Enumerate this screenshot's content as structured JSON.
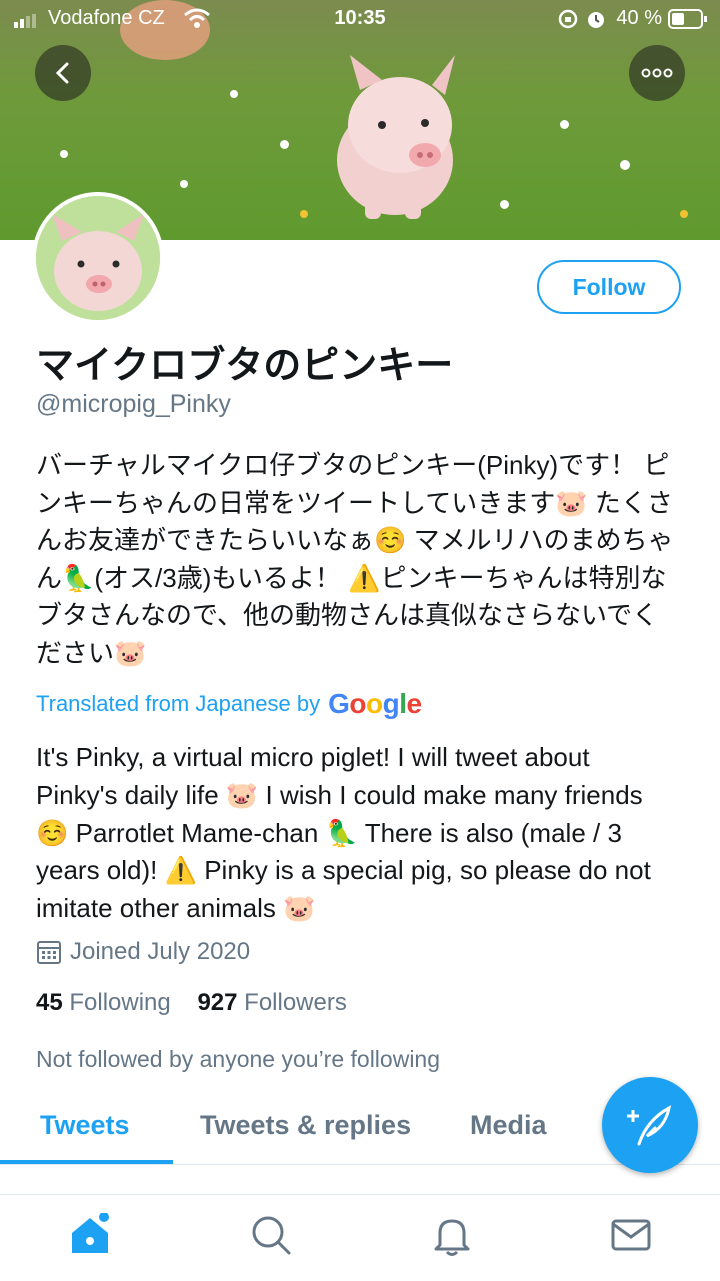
{
  "status_bar": {
    "carrier": "Vodafone CZ",
    "time": "10:35",
    "battery": "40 %"
  },
  "profile": {
    "display_name": "マイクロブタのピンキー",
    "handle": "@micropig_Pinky",
    "bio_original": "バーチャルマイクロ仔ブタのピンキー(Pinky)です！ ピンキーちゃんの日常をツイートしていきます🐷 たくさんお友達ができたらいいなぁ☺️ マメルリハのまめちゃん🦜(オス/3歳)もいるよ！ ⚠️ピンキーちゃんは特別なブタさんなので、他の動物さんは真似なさらないでください🐷",
    "translated_label": "Translated from Japanese by",
    "translator": "Google",
    "bio_translated": "It's Pinky, a virtual micro piglet! I will tweet about Pinky's daily life 🐷 I wish I could make many friends ☺️ Parrotlet Mame-chan 🦜 There is also (male / 3 years old)! ⚠️ Pinky is a special pig, so please do not imitate other animals 🐷",
    "joined": "Joined July 2020",
    "following_count": "45",
    "following_label": "Following",
    "followers_count": "927",
    "followers_label": "Followers",
    "not_followed_note": "Not followed by anyone you’re following",
    "follow_button": "Follow"
  },
  "tabs": [
    {
      "label": "Tweets",
      "active": true
    },
    {
      "label": "Tweets & replies",
      "active": false
    },
    {
      "label": "Media",
      "active": false
    }
  ],
  "icons": {
    "back": "back-arrow-icon",
    "more": "more-dots-icon",
    "compose": "compose-tweet-icon",
    "home": "home-icon",
    "search": "search-icon",
    "notifications": "bell-icon",
    "messages": "mail-icon",
    "calendar": "calendar-icon"
  },
  "colors": {
    "accent": "#1da1f2",
    "secondary_text": "#657786",
    "primary_text": "#14171a"
  }
}
